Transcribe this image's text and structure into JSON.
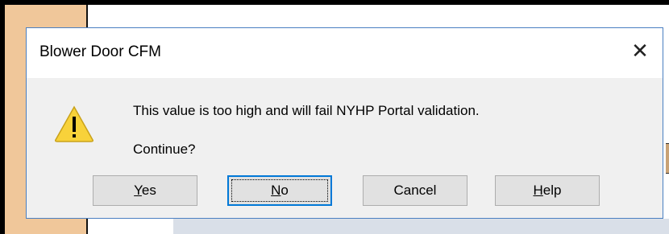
{
  "dialog": {
    "title": "Blower Door CFM",
    "close_glyph": "✕",
    "icon": "warning-icon",
    "message": "This value is too high and will fail NYHP Portal validation.",
    "question": "Continue?"
  },
  "buttons": [
    {
      "mnemonic": "Y",
      "rest": "es",
      "label": "Yes"
    },
    {
      "mnemonic": "N",
      "rest": "o",
      "label": "No",
      "default": true
    },
    {
      "mnemonic": "",
      "rest": "Cancel",
      "label": "Cancel"
    },
    {
      "mnemonic": "H",
      "rest": "elp",
      "label": "Help"
    }
  ],
  "colors": {
    "dialog_border": "#4a7fc1",
    "default_button_border": "#0078d7",
    "warning_fill": "#f8d23a"
  }
}
